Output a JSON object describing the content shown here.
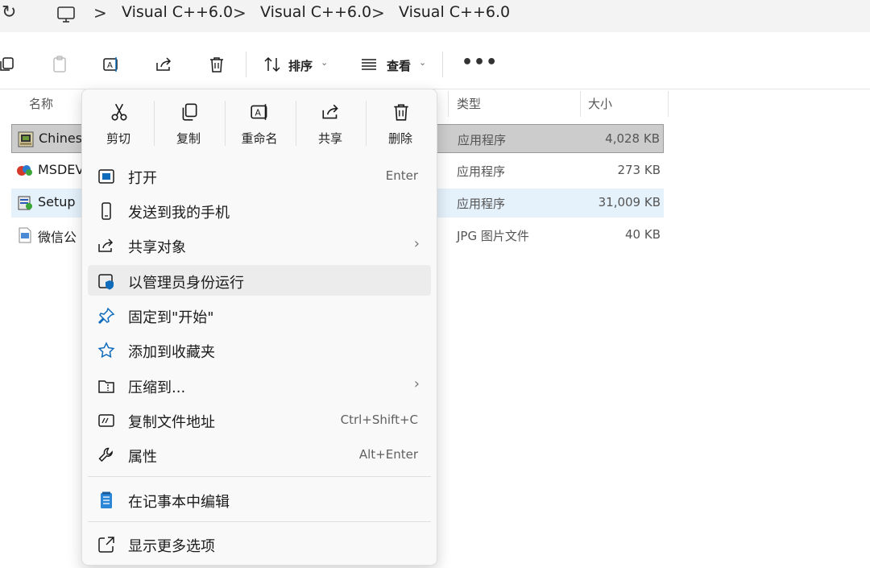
{
  "address": {
    "refresh_icon": "refresh-icon",
    "computer_icon": "computer-icon",
    "crumbs": [
      "Visual C++6.0",
      "Visual C++6.0",
      "Visual C++6.0"
    ],
    "separator": ">"
  },
  "toolbar": {
    "sort_label": "排序",
    "view_label": "查看",
    "more_label": "•••"
  },
  "columns": {
    "name": "名称",
    "type": "类型",
    "size": "大小"
  },
  "files": [
    {
      "name": "Chines",
      "type": "应用程序",
      "size": "4,028 KB",
      "state": "selected"
    },
    {
      "name": "MSDEV",
      "type": "应用程序",
      "size": "273 KB",
      "state": "normal"
    },
    {
      "name": "Setup",
      "type": "应用程序",
      "size": "31,009 KB",
      "state": "hover"
    },
    {
      "name": "微信公",
      "type": "JPG 图片文件",
      "size": "40 KB",
      "state": "normal"
    }
  ],
  "context_menu": {
    "quick_actions": [
      {
        "label": "剪切",
        "icon": "cut-icon"
      },
      {
        "label": "复制",
        "icon": "copy-icon"
      },
      {
        "label": "重命名",
        "icon": "rename-icon"
      },
      {
        "label": "共享",
        "icon": "share-icon"
      },
      {
        "label": "删除",
        "icon": "delete-icon"
      }
    ],
    "items": [
      {
        "label": "打开",
        "shortcut": "Enter",
        "icon": "open-icon"
      },
      {
        "label": "发送到我的手机",
        "shortcut": "",
        "icon": "phone-icon"
      },
      {
        "label": "共享对象",
        "submenu": true,
        "icon": "share-icon"
      },
      {
        "label": "以管理员身份运行",
        "highlighted": true,
        "icon": "admin-shield-icon"
      },
      {
        "label": "固定到\"开始\"",
        "icon": "pin-icon"
      },
      {
        "label": "添加到收藏夹",
        "icon": "star-icon"
      },
      {
        "label": "压缩到...",
        "submenu": true,
        "icon": "zip-folder-icon"
      },
      {
        "label": "复制文件地址",
        "shortcut": "Ctrl+Shift+C",
        "icon": "copy-path-icon"
      },
      {
        "label": "属性",
        "shortcut": "Alt+Enter",
        "icon": "wrench-icon"
      },
      {
        "label": "在记事本中编辑",
        "icon": "notepad-icon"
      },
      {
        "label": "显示更多选项",
        "icon": "more-options-icon"
      }
    ]
  },
  "colors": {
    "accent": "#0f6cbd",
    "selected_row": "#cccccc",
    "hover_row": "#e5f1fb",
    "menu_bg": "#f9f9f9"
  }
}
